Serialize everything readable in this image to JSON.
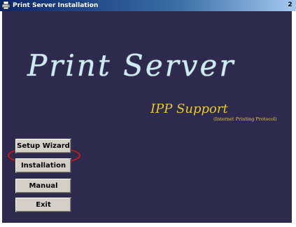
{
  "window": {
    "title": "Print Server Installation",
    "close_glyph": "2",
    "title_icon": "printer-setup-icon"
  },
  "brand": {
    "title": "Print Server",
    "subtitle": "IPP Support",
    "subtitle_detail": "(Internet Printing Protocol)"
  },
  "menu": [
    {
      "label": "Setup Wizard",
      "highlighted": true
    },
    {
      "label": "Installation",
      "highlighted": false
    },
    {
      "label": "Manual",
      "highlighted": false
    },
    {
      "label": "Exit",
      "highlighted": false
    }
  ],
  "colors": {
    "background": "#2d2a4d",
    "title_text": "#cdebf0",
    "subtitle_text": "#e6c93a",
    "highlight": "#d01818"
  }
}
